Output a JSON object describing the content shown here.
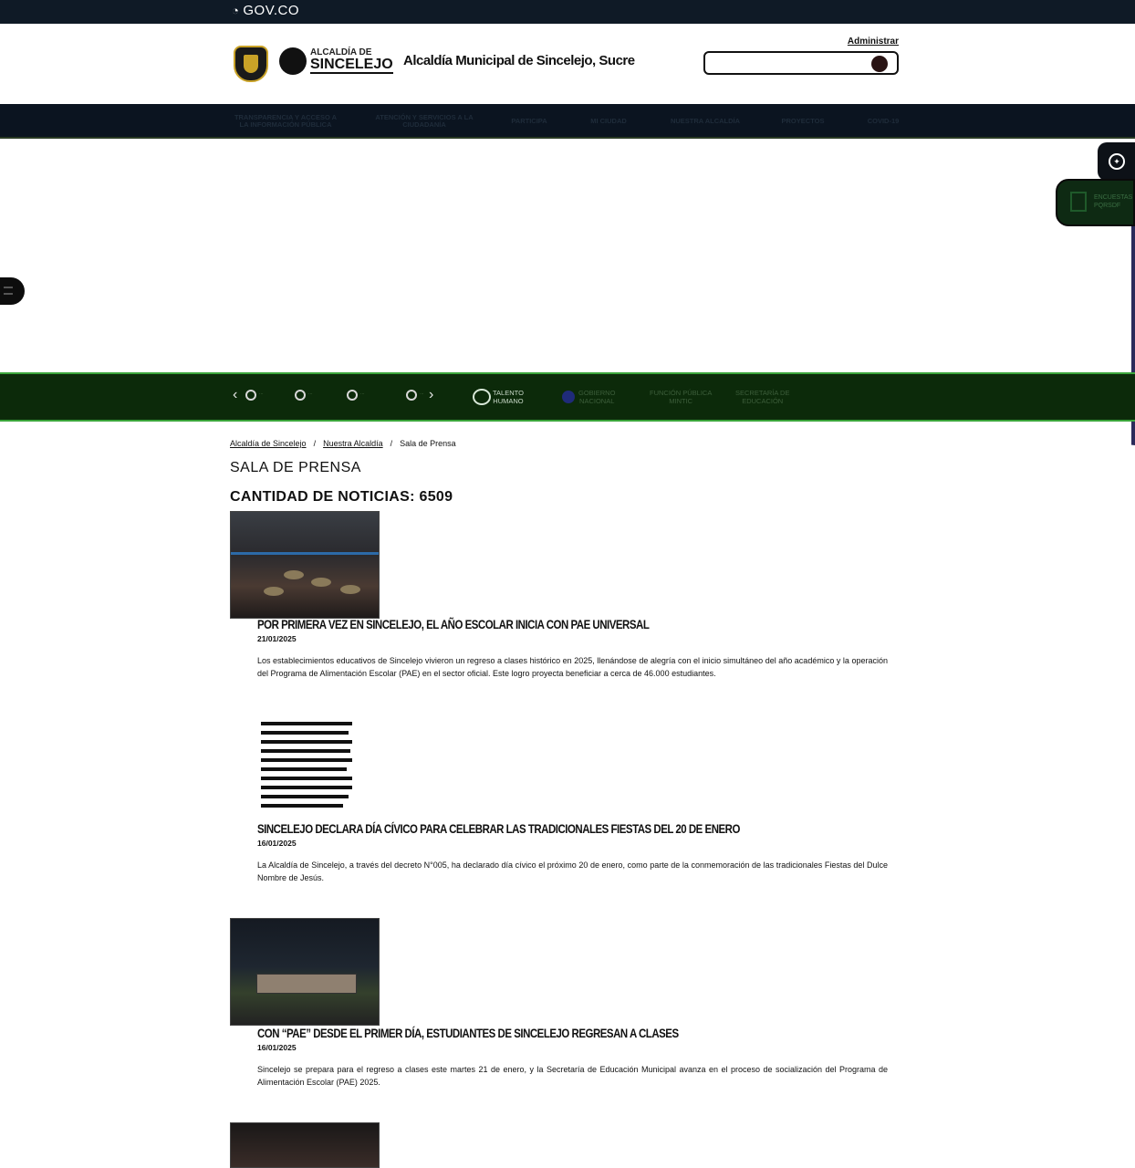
{
  "gov_bar": {
    "logo_text": "GOV.CO"
  },
  "header": {
    "city_logo_small": "ALCALDÍA DE",
    "city_logo_big": "SINCELEJO",
    "site_title": "Alcaldía Municipal de Sincelejo, Sucre",
    "admin_link": "Administrar",
    "search_placeholder": ""
  },
  "nav": {
    "items": [
      "TRANSPARENCIA Y ACCESO A LA INFORMACIÓN PÚBLICA",
      "ATENCIÓN Y SERVICIOS A LA CIUDADANÍA",
      "PARTICIPA",
      "MI CIUDAD",
      "NUESTRA ALCALDÍA",
      "PROYECTOS",
      "COVID-19"
    ]
  },
  "side_widgets": {
    "widget_b_label_1": "ENCUESTAS",
    "widget_b_label_2": "PQRSDF"
  },
  "partners": {
    "carousel_tiny": [
      "...",
      "...",
      "...",
      "..."
    ],
    "talento_line1": "TALENTO",
    "talento_line2": "HUMANO",
    "gov_line1": "GOBIERNO",
    "gov_line2": "NACIONAL",
    "funcion_line1": "FUNCIÓN PÚBLICA",
    "funcion_line2": "MINTIC",
    "sec_line1": "SECRETARÍA DE",
    "sec_line2": "EDUCACIÓN"
  },
  "breadcrumb": {
    "items": [
      "Alcaldía de Sincelejo",
      "Nuestra Alcaldía",
      "Sala de Prensa"
    ],
    "separator": "/"
  },
  "page": {
    "title": "SALA DE PRENSA",
    "count_label": "CANTIDAD DE NOTICIAS:",
    "count_value": "6509"
  },
  "news": [
    {
      "title": "POR PRIMERA VEZ EN SINCELEJO, EL AÑO ESCOLAR INICIA CON PAE UNIVERSAL",
      "date": "21/01/2025",
      "summary": "Los establecimientos educativos de Sincelejo vivieron un regreso a clases histórico en 2025, llenándose de alegría con el inicio simultáneo del año académico y la operación del Programa de Alimentación Escolar (PAE) en el sector oficial. Este logro proyecta beneficiar a cerca de 46.000 estudiantes."
    },
    {
      "title": "SINCELEJO DECLARA DÍA CÍVICO PARA CELEBRAR LAS TRADICIONALES FIESTAS DEL 20 DE ENERO",
      "date": "16/01/2025",
      "summary": "La Alcaldía de Sincelejo, a través del decreto N°005, ha declarado día cívico el próximo 20 de enero, como parte de la conmemoración de las tradicionales Fiestas del Dulce Nombre de Jesús."
    },
    {
      "title": "CON “PAE” DESDE EL PRIMER DÍA, ESTUDIANTES DE SINCELEJO REGRESAN A CLASES",
      "date": "16/01/2025",
      "summary": "Sincelejo se prepara para el regreso a clases este martes 21 de enero, y la Secretaría de Educación Municipal avanza en el proceso de socialización del Programa de Alimentación Escolar (PAE) 2025."
    }
  ],
  "colors": {
    "gov_bar": "#0f1a26",
    "nav_bg": "#0b1420",
    "green_band": "#0c2a0a",
    "green_border": "#3ba53b"
  }
}
